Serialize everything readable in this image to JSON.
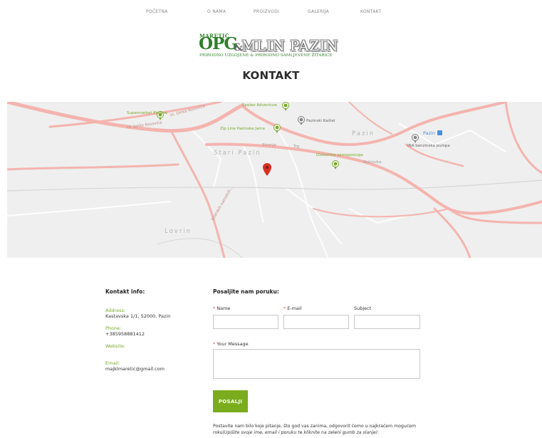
{
  "nav": {
    "items": [
      {
        "label": "POČETNA"
      },
      {
        "label": "O NAMA"
      },
      {
        "label": "PROIZVODI"
      },
      {
        "label": "GALERIJA"
      },
      {
        "label": "KONTAKT"
      }
    ]
  },
  "logo": {
    "maretic": "MARETIĆ",
    "opg": "OPG",
    "amp": "&",
    "mlin": "MLIN PAZIN",
    "tagline": "PRIRODNO UZGOJENE & PRIRODNO SAMLJEVENE ŽITARICE"
  },
  "page": {
    "title": "KONTAKT"
  },
  "map": {
    "places": [
      "Stari Pazin",
      "Pazin",
      "Lovrin"
    ],
    "pois": [
      {
        "label": "Supermarket Plodine",
        "color": "#7aa82a"
      },
      {
        "label": "Speleo Adventure",
        "color": "#7aa82a"
      },
      {
        "label": "Pazinski Kaštel",
        "color": "#666666"
      },
      {
        "label": "Zip Line Pazinska Jama",
        "color": "#7aa82a"
      },
      {
        "label": "Diskontna samoposluga",
        "color": "#7aa82a"
      },
      {
        "label": "Pazin",
        "color": "#4a90d9"
      },
      {
        "label": "INA benzinska pumpa",
        "color": "#666666"
      }
    ],
    "roads": [
      "Ul. Dinka Kosovića",
      "Ul. Janka Kosovića",
      "Istarskih narodnih...",
      "Stranja",
      "Trg",
      "Dršćevka"
    ],
    "colors": {
      "marker": "#d93025",
      "road": "#f4b4ae",
      "land": "#efefef"
    }
  },
  "info": {
    "heading": "Kontakt info:",
    "address_label": "Address:",
    "address": "Kastavska 1/1, 52000, Pazin",
    "phone_label": "Phone:",
    "phone": "+385958881412",
    "website_label": "Website:",
    "email_label": "Email:",
    "email": "majklmaretic@gmail.com"
  },
  "form": {
    "heading": "Posaljite nam poruku:",
    "name_label": "Name",
    "email_label": "E-mail",
    "subject_label": "Subject",
    "message_label": "Your Message",
    "name_value": "",
    "email_value": "",
    "subject_value": "",
    "message_value": "",
    "submit_label": "POSALJI",
    "note_plain": "Postavite nam bilo koje pitanje, što god vas zanima, odgovorit ćemo u najkraćem mogućem roku",
    "note_italic": "(Upišite svoje ime, email i poruku te kliknite na zeleni gumb za slanje)",
    "note_end": ".",
    "colors": {
      "accent": "#7aac1d",
      "required": "#d9534f"
    }
  }
}
